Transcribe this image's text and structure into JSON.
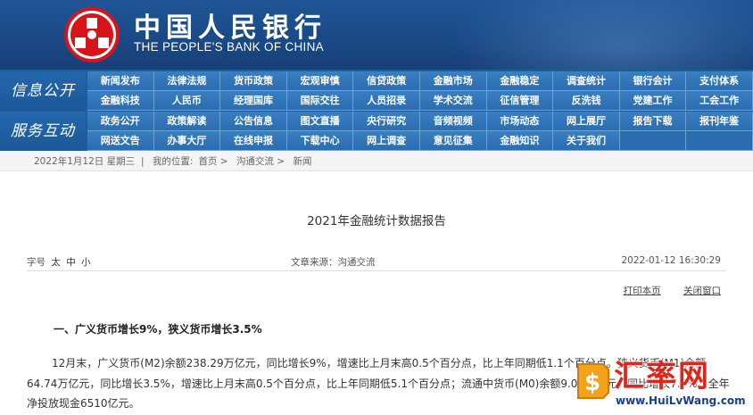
{
  "header": {
    "brand_cn": "中国人民银行",
    "brand_en": "THE PEOPLE'S BANK OF CHINA"
  },
  "nav": {
    "block1_label": "信息公开",
    "block1_row1": [
      "新闻发布",
      "法律法规",
      "货币政策",
      "宏观审慎",
      "信贷政策",
      "金融市场",
      "金融稳定",
      "调查统计",
      "银行会计",
      "支付体系"
    ],
    "block1_row2": [
      "金融科技",
      "人民币",
      "经理国库",
      "国际交往",
      "人员招录",
      "学术交流",
      "征信管理",
      "反洗钱",
      "党建工作",
      "工会工作"
    ],
    "block2_label": "服务互动",
    "block2_row1": [
      "政务公开",
      "政策解读",
      "公告信息",
      "图文直播",
      "央行研究",
      "音频视频",
      "市场动态",
      "网上展厅",
      "报告下载",
      "报刊年鉴"
    ],
    "block2_row2": [
      "网送文告",
      "办事大厅",
      "在线申报",
      "下载中心",
      "网上调查",
      "意见征集",
      "金融知识",
      "关于我们",
      "",
      ""
    ]
  },
  "breadcrumb": {
    "date": "2022年1月12日  星期三",
    "location_label": "我的位置:",
    "items": [
      "首页",
      "沟通交流",
      "新闻"
    ]
  },
  "article": {
    "title": "2021年金融统计数据报告",
    "font_size_label": "字号",
    "font_sizes": [
      "太",
      "中",
      "小"
    ],
    "source": "文章来源：沟通交流",
    "timestamp": "2022-01-12  16:30:29",
    "print_label": "打印本页",
    "close_label": "关闭窗口",
    "section_heading": "一、广义货币增长9%，狭义货币增长3.5%",
    "paragraph": "12月末，广义货币(M2)余额238.29万亿元，同比增长9%，增速比上月末高0.5个百分点，比上年同期低1.1个百分点。狭义货币(M1)余额64.74万亿元，同比增长3.5%，增速比上月末高0.5个百分点，比上年同期低5.1个百分点；流通中货币(M0)余额9.08万亿元，同比增长7.7%。全年净投放现金6510亿元。"
  },
  "watermark": {
    "text": "汇率网",
    "url": "www.HuiLvWang.com"
  },
  "colors": {
    "header_blue": "#1a4a86",
    "nav_blue": "#2a6db0",
    "logo_red": "#d7141a",
    "watermark_red": "#e0261b"
  }
}
